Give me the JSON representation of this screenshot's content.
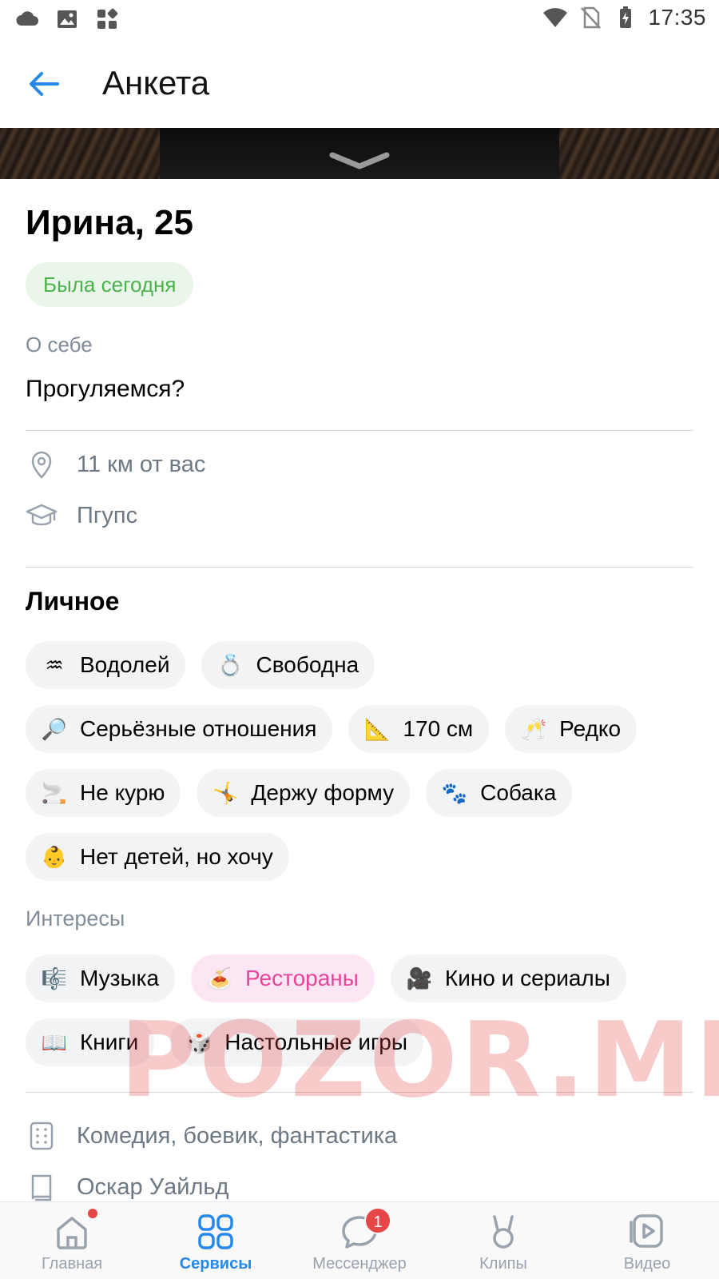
{
  "status_bar": {
    "time": "17:35",
    "left_icons": [
      "cloud-icon",
      "image-icon",
      "apps-icon"
    ],
    "right_icons": [
      "wifi-icon",
      "no-sim-icon",
      "battery-charging-icon"
    ]
  },
  "header": {
    "title": "Анкета",
    "back_icon": "arrow-left-icon"
  },
  "profile": {
    "name_age": "Ирина, 25",
    "online_status": "Была сегодня",
    "about_label": "О себе",
    "about_text": "Прогуляемся?",
    "distance": "11 км от вас",
    "education": "Пгупс"
  },
  "personal": {
    "title": "Личное",
    "chips": [
      {
        "emoji": "♒",
        "label": "Водолей"
      },
      {
        "emoji": "💍",
        "label": "Свободна"
      },
      {
        "emoji": "🔎",
        "label": "Серьёзные отношения"
      },
      {
        "emoji": "📐",
        "label": "170 см"
      },
      {
        "emoji": "🥂",
        "label": "Редко"
      },
      {
        "emoji": "🚬",
        "label": "Не курю"
      },
      {
        "emoji": "🤸",
        "label": "Держу форму"
      },
      {
        "emoji": "🐾",
        "label": "Собака"
      },
      {
        "emoji": "👶",
        "label": "Нет детей, но хочу"
      }
    ]
  },
  "interests": {
    "title": "Интересы",
    "chips": [
      {
        "emoji": "🎼",
        "label": "Музыка",
        "active": false
      },
      {
        "emoji": "🍝",
        "label": "Рестораны",
        "active": true
      },
      {
        "emoji": "🎥",
        "label": "Кино и сериалы",
        "active": false
      },
      {
        "emoji": "📖",
        "label": "Книги",
        "active": false
      },
      {
        "emoji": "🎲",
        "label": "Настольные игры",
        "active": false
      }
    ]
  },
  "details": {
    "movies": "Комедия, боевик, фантастика",
    "books": "Оскар Уайльд"
  },
  "watermark": "POZOR.ME",
  "colors": {
    "accent": "#2688eb",
    "online_green": "#4bb34b",
    "active_chip_text": "#e64599",
    "badge_red": "#e64646"
  },
  "tabs": [
    {
      "label": "Главная",
      "icon": "home-icon",
      "active": false,
      "dot": true
    },
    {
      "label": "Сервисы",
      "icon": "services-icon",
      "active": true
    },
    {
      "label": "Мессенджер",
      "icon": "messenger-icon",
      "active": false,
      "badge": "1"
    },
    {
      "label": "Клипы",
      "icon": "clips-icon",
      "active": false
    },
    {
      "label": "Видео",
      "icon": "video-icon",
      "active": false
    }
  ]
}
